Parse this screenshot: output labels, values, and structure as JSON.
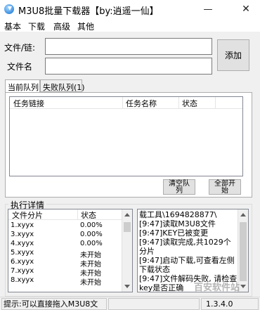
{
  "window": {
    "title": "M3U8批量下载器【by:逍遥一仙】",
    "minimize_glyph": "—",
    "close_glyph": "✕"
  },
  "menu": [
    "基本",
    "下载",
    "高级",
    "其他"
  ],
  "form": {
    "file_link_label": "文件/链:",
    "file_link_value": "",
    "file_name_label": "文件名",
    "file_name_value": "",
    "add_button": "添加"
  },
  "tabs": [
    {
      "label": "当前队列",
      "active": true
    },
    {
      "label": "失败队列(1)",
      "active": false
    }
  ],
  "queue": {
    "columns": [
      "任务链接",
      "任务名称",
      "状态"
    ],
    "rows": []
  },
  "queue_buttons": {
    "clear": "清空队\n列",
    "start_all": "全部开\n始"
  },
  "details": {
    "group_title": "执行详情",
    "columns": [
      "文件分片",
      "状态"
    ],
    "rows": [
      {
        "name": "1.xyyx",
        "status": "0.00%"
      },
      {
        "name": "3.xyyx",
        "status": "0.00%"
      },
      {
        "name": "4.xyyx",
        "status": "0.00%"
      },
      {
        "name": "5.xyyx",
        "status": "未开始"
      },
      {
        "name": "6.xyyx",
        "status": "未开始"
      },
      {
        "name": "7.xyyx",
        "status": "未开始"
      },
      {
        "name": "8.xyyx",
        "status": "未开始"
      }
    ]
  },
  "log": {
    "text": "载工具\\1694828877\\\n[9:47]读取M3U8文件\n[9:47]KEY已被变更\n[9:47]读取完成,共1029个分片\n[9:47]启动下载,可查看左侧下载状态\n[9:47]文件解码失败, 请检查key是否正确"
  },
  "statusbar": {
    "hint": "提示:可以直接拖入M3U8文",
    "version": "1.3.4.0"
  },
  "watermark": "百安软件站"
}
